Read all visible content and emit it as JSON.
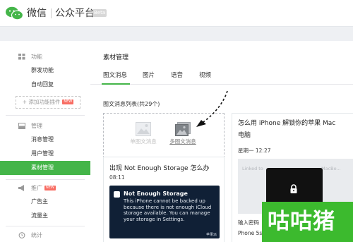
{
  "header": {
    "brand": "微信",
    "subtitle": "公众平台",
    "beta_label": "Beta"
  },
  "sidebar": {
    "groups": [
      {
        "title": "功能",
        "icon": "grid-icon",
        "items": [
          {
            "label": "群发功能"
          },
          {
            "label": "自动回复"
          }
        ]
      },
      {
        "title": "管理",
        "icon": "inbox-icon",
        "items": [
          {
            "label": "消息管理"
          },
          {
            "label": "用户管理"
          },
          {
            "label": "素材管理",
            "active": true
          }
        ]
      },
      {
        "title": "推广",
        "icon": "megaphone-icon",
        "badge": "NEW",
        "items": [
          {
            "label": "广告主"
          },
          {
            "label": "流量主"
          }
        ]
      },
      {
        "title": "统计",
        "icon": "clock-icon",
        "items": []
      }
    ],
    "add_plugin_label": "+ 添加功能插件",
    "add_plugin_badge": "NEW"
  },
  "main": {
    "title": "素材管理",
    "tabs": [
      {
        "label": "图文消息",
        "active": true
      },
      {
        "label": "图片"
      },
      {
        "label": "语音"
      },
      {
        "label": "视频"
      }
    ],
    "list_caption": "图文消息列表(共29个)",
    "create": {
      "single_label": "单图文消息",
      "multi_label": "多图文消息"
    },
    "articles": [
      {
        "title": "出现 Not Enough Storage 怎么办",
        "time": "08:11",
        "image": {
          "alert_title": "Not Enough Storage",
          "alert_body": "This iPhone cannot be backed up because there is not enough iCloud storage available. You can manage your storage in Settings.",
          "watermark": "苹果派"
        }
      },
      {
        "title": "怎么用 iPhone 解锁你的苹果 Mac 电脑",
        "time": "星期一 12:27",
        "image": {
          "faint_left": "Linked to",
          "faint_right": "MacBo..."
        },
        "text_lines": [
          "输入密码",
          "Phone 5s"
        ]
      }
    ]
  },
  "watermark": {
    "text": "咕咕猪"
  },
  "colors": {
    "accent": "#44b549",
    "watermark_bg": "#3cba2e",
    "tag_red": "#f86c62"
  }
}
